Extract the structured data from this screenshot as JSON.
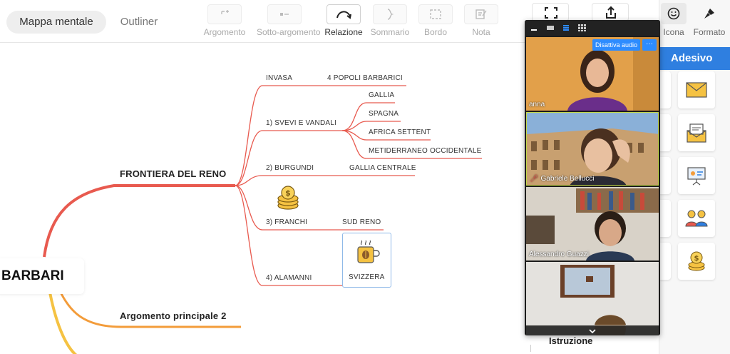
{
  "toolbar": {
    "views": {
      "mind_map": "Mappa mentale",
      "outliner": "Outliner"
    },
    "tools": [
      {
        "label": "Argomento",
        "icon": "topic-icon",
        "active": false
      },
      {
        "label": "Sotto-argomento",
        "icon": "subtopic-icon",
        "active": false
      },
      {
        "label": "Relazione",
        "icon": "relation-icon",
        "active": true
      },
      {
        "label": "Sommario",
        "icon": "summary-icon",
        "active": false
      },
      {
        "label": "Bordo",
        "icon": "boundary-icon",
        "active": false
      },
      {
        "label": "Nota",
        "icon": "note-icon",
        "active": false
      }
    ]
  },
  "mindmap": {
    "central": "BARBARI",
    "main_topic": "FRONTIERA DEL RENO",
    "main_topic_2": "Argomento principale 2",
    "subtopics": [
      {
        "label": "INVASA",
        "child": "4 POPOLI BARBARICI"
      },
      {
        "label": "1) SVEVI E VANDALI",
        "children": [
          "GALLIA",
          "SPAGNA",
          "AFRICA SETTENT",
          "METIDERRANEO OCCIDENTALE"
        ]
      },
      {
        "label": "2) BURGUNDI",
        "child": "GALLIA CENTRALE"
      },
      {
        "label": "3) FRANCHI",
        "child": "SUD RENO"
      },
      {
        "label": "4) ALAMANNI",
        "child": "SVIZZERA"
      }
    ],
    "branch_colors": {
      "main": "#e85a4f",
      "second": "#f39c3a",
      "third": "#f5c242"
    }
  },
  "right_panel": {
    "tabs": {
      "icon": "Icona",
      "format": "Formato"
    },
    "section_title": "Adesivo",
    "stickers": [
      "envelope-icon",
      "letter-icon",
      "presentation-icon",
      "people-icon",
      "coins-icon"
    ],
    "instruction": "Istruzione"
  },
  "video": {
    "mute_label": "Disattiva audio",
    "more_label": "···",
    "participants": [
      {
        "name": "anna"
      },
      {
        "name": "Gabriele Bellucci"
      },
      {
        "name": "Alessandro Guazzi"
      },
      {
        "name": ""
      }
    ]
  },
  "colors": {
    "accent": "#2f7fe0",
    "zoom_blue": "#2d8cff"
  }
}
